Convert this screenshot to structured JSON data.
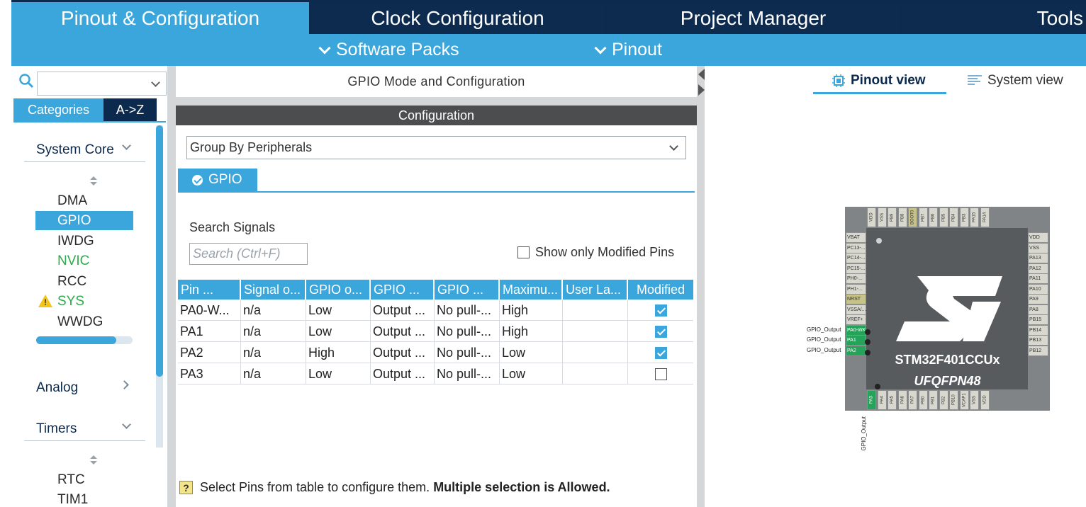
{
  "top_tabs": [
    "Pinout & Configuration",
    "Clock Configuration",
    "Project Manager",
    "Tools"
  ],
  "sub_menu": [
    "Software Packs",
    "Pinout"
  ],
  "sidebar": {
    "tabs": [
      "Categories",
      "A->Z"
    ],
    "categories": [
      {
        "label": "System Core",
        "items": [
          "DMA",
          "GPIO",
          "IWDG",
          "NVIC",
          "SYS",
          "WWDG"
        ]
      },
      {
        "label": "Analog"
      },
      {
        "label": "Timers",
        "items": [
          "RTC",
          "TIM1"
        ]
      }
    ]
  },
  "middle": {
    "title": "GPIO Mode and Configuration",
    "config_header": "Configuration",
    "group_select": "Group By Peripherals",
    "gpio_tab": "GPIO",
    "search_label": "Search Signals",
    "search_placeholder": "Search (Ctrl+F)",
    "modified_label": "Show only Modified Pins",
    "table": {
      "headers": [
        "Pin ...",
        "Signal o...",
        "GPIO o...",
        "GPIO ...",
        "GPIO ...",
        "Maximu...",
        "User La...",
        "Modified"
      ],
      "rows": [
        [
          "PA0-W...",
          "n/a",
          "Low",
          "Output ...",
          "No pull-...",
          "High",
          "",
          true
        ],
        [
          "PA1",
          "n/a",
          "Low",
          "Output ...",
          "No pull-...",
          "High",
          "",
          true
        ],
        [
          "PA2",
          "n/a",
          "High",
          "Output ...",
          "No pull-...",
          "Low",
          "",
          true
        ],
        [
          "PA3",
          "n/a",
          "Low",
          "Output ...",
          "No pull-...",
          "Low",
          "",
          false
        ]
      ]
    },
    "hint_normal": "Select Pins from table to configure them.",
    "hint_bold": "Multiple selection is Allowed."
  },
  "right": {
    "views": [
      "Pinout view",
      "System view"
    ],
    "chip_name": "STM32F401CCUx",
    "chip_package": "UFQFPN48",
    "top_pins": [
      "VDD",
      "VSS",
      "PB9",
      "PB8",
      "BOOT0",
      "PB7",
      "PB6",
      "PB5",
      "PB4",
      "PB3",
      "PA15",
      "PA14"
    ],
    "left_pins": [
      "VBAT",
      "PC13-...",
      "PC14-...",
      "PC15-...",
      "PH0-...",
      "PH1-...",
      "NRST",
      "VSSA/...",
      "VREF+",
      "PA0-WK...",
      "PA1",
      "PA2"
    ],
    "right_pins": [
      "VDD",
      "VSS",
      "PA13",
      "PA12",
      "PA11",
      "PA10",
      "PA9",
      "PA8",
      "PB15",
      "PB14",
      "PB13",
      "PB12"
    ],
    "bottom_pins": [
      "PA3",
      "PA4",
      "PA5",
      "PA6",
      "PA7",
      "PB0",
      "PB1",
      "PB2",
      "PB10",
      "VCAP1",
      "VSS",
      "VDD"
    ],
    "gpio_labels": [
      "GPIO_Output",
      "GPIO_Output",
      "GPIO_Output",
      "GPIO_Output"
    ]
  },
  "colors": {
    "accent": "#3aa6dc",
    "navy": "#0b2a4e",
    "green": "#2eaa4c",
    "pin_green": "#26a35a"
  }
}
